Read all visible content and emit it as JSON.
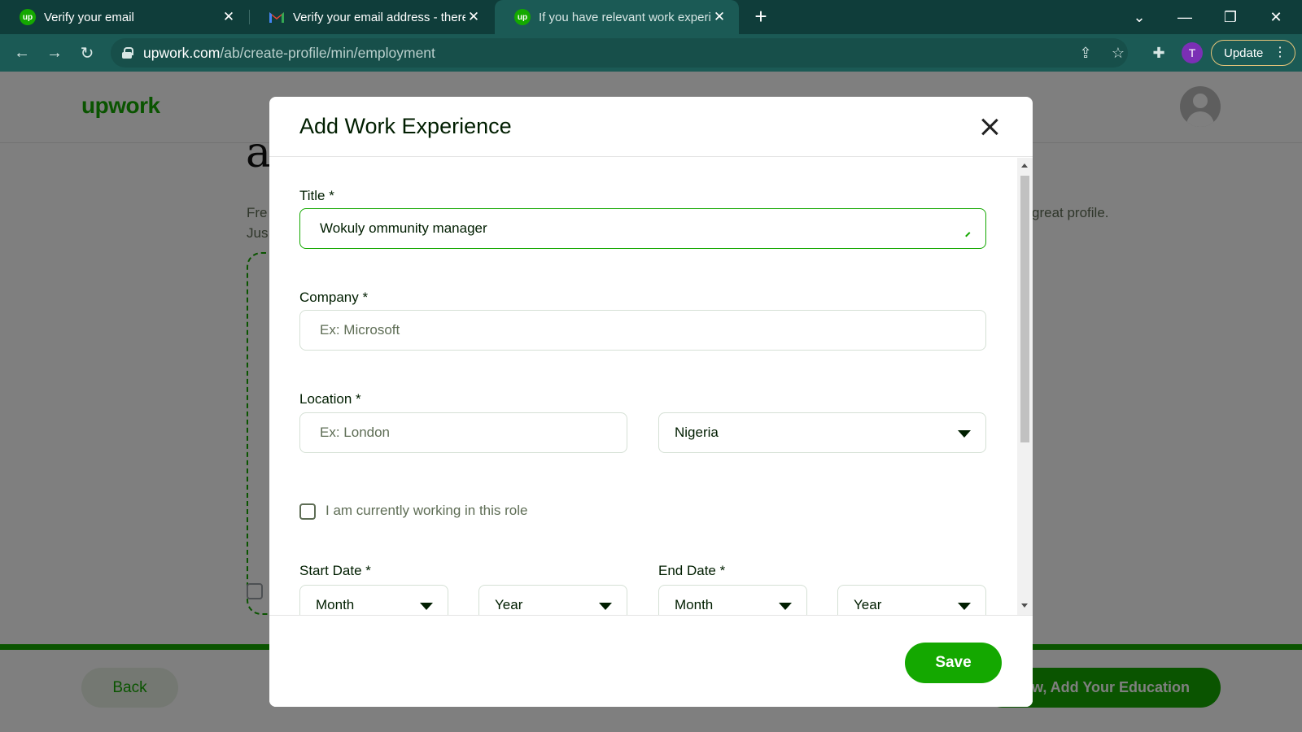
{
  "browser": {
    "tabs": [
      {
        "title": "Verify your email",
        "favicon": "upwork-icon"
      },
      {
        "title": "Verify your email address - there",
        "favicon": "gmail-icon"
      },
      {
        "title": "If you have relevant work experie",
        "favicon": "upwork-icon",
        "active": true
      }
    ],
    "url_host": "upwork.com",
    "url_path": "/ab/create-profile/min/employment",
    "profile_initial": "T",
    "update_label": "Update"
  },
  "page": {
    "logo": "upwork",
    "heading_fragment": "a",
    "intro_line1_fragment": "Fre",
    "intro_line2_fragment": "Jus",
    "right_text_fragment": "great profile.",
    "back_label": "Back",
    "next_label_fragment": "w, Add Your Education"
  },
  "modal": {
    "title": "Add Work Experience",
    "title_label": "Title *",
    "title_value": "Wokuly ommunity manager",
    "company_label": "Company *",
    "company_placeholder": "Ex: Microsoft",
    "location_label": "Location *",
    "city_placeholder": "Ex: London",
    "country_value": "Nigeria",
    "current_role_label": "I am currently working in this role",
    "current_role_checked": false,
    "start_date_label": "Start Date *",
    "end_date_label": "End Date *",
    "month_placeholder": "Month",
    "year_placeholder": "Year",
    "save_label": "Save"
  },
  "colors": {
    "brand_green": "#14a800",
    "chrome_dark": "#0f3d3a",
    "chrome_toolbar": "#1b5a55"
  }
}
